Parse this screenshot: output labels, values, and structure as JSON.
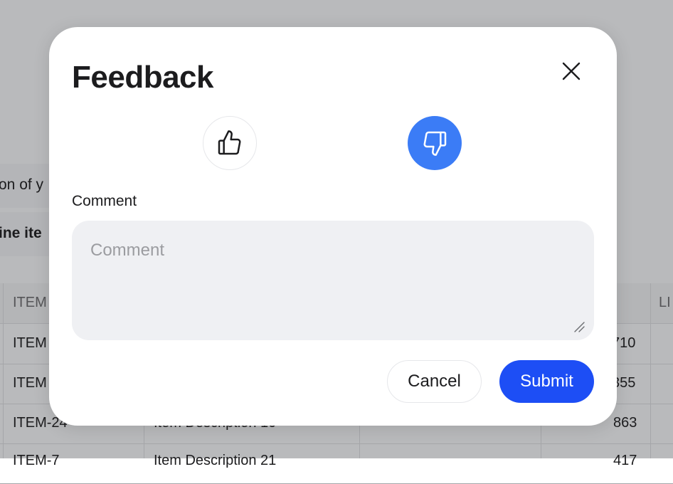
{
  "background": {
    "snippet_text": "on of y",
    "bold_text": "ine ite",
    "table": {
      "header": {
        "col1": "ITEM",
        "col5": "LI"
      },
      "rows": [
        {
          "col1": "ITEM",
          "col4": "710"
        },
        {
          "col1": "ITEM",
          "col4": "355"
        },
        {
          "col1": "ITEM-24",
          "col2": "Item Description 10",
          "col4": "863"
        },
        {
          "col1": "ITEM-7",
          "col2": "Item Description 21",
          "col4": "417"
        }
      ]
    }
  },
  "modal": {
    "title": "Feedback",
    "close_icon": "close-icon",
    "thumbs_up_icon": "thumbs-up-icon",
    "thumbs_down_icon": "thumbs-down-icon",
    "selected_vote": "thumbs-down",
    "comment_label": "Comment",
    "comment_placeholder": "Comment",
    "comment_value": "",
    "cancel_label": "Cancel",
    "submit_label": "Submit"
  },
  "colors": {
    "accent_selected": "#3b7cf6",
    "primary_button": "#1d4ef5",
    "backdrop": "#b9babc",
    "input_bg": "#eff0f3"
  }
}
